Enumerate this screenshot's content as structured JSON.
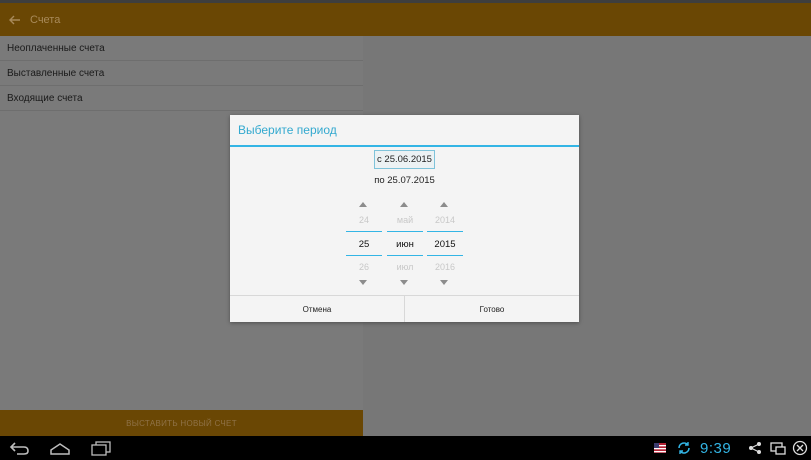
{
  "actionbar": {
    "back_icon": "arrow-left-icon",
    "title": "Счета"
  },
  "sidebar": {
    "items": [
      {
        "label": "Неоплаченные счета"
      },
      {
        "label": "Выставленные счета"
      },
      {
        "label": "Входящие счета"
      }
    ],
    "bottom_button": "ВЫСТАВИТЬ НОВЫЙ СЧЕТ"
  },
  "dialog": {
    "title": "Выберите период",
    "range_from": "с 25.06.2015",
    "range_to": "по 25.07.2015",
    "picker": {
      "day": {
        "prev": "24",
        "current": "25",
        "next": "26"
      },
      "month": {
        "prev": "май",
        "current": "июн",
        "next": "июл"
      },
      "year": {
        "prev": "2014",
        "current": "2015",
        "next": "2016"
      }
    },
    "cancel_label": "Отмена",
    "done_label": "Готово"
  },
  "systembar": {
    "clock": "9:39",
    "icons": [
      "back-icon",
      "home-icon",
      "recent-apps-icon",
      "flag-icon",
      "sync-icon",
      "share-icon",
      "screen-icon",
      "close-icon"
    ]
  },
  "colors": {
    "accent": "#33b5e5",
    "actionbar": "#6a4704",
    "dialog_bg": "#f4f4f4"
  }
}
